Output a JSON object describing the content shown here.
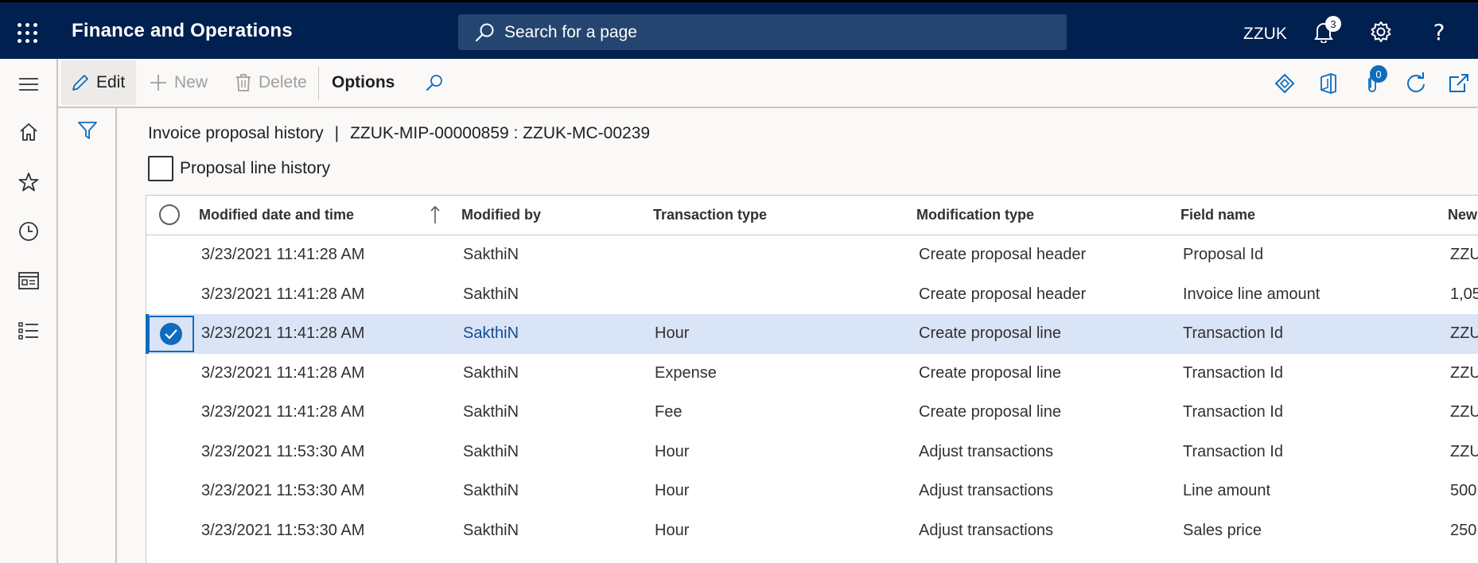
{
  "app": {
    "title": "Finance and Operations",
    "search_placeholder": "Search for a page",
    "company": "ZZUK",
    "notifications_count": "3"
  },
  "nav": {
    "items": [
      "hamburger-icon",
      "home-icon",
      "star-icon",
      "clock-icon",
      "workspace-icon",
      "list-icon"
    ]
  },
  "actions": {
    "edit": "Edit",
    "new": "New",
    "delete": "Delete",
    "options": "Options",
    "attachments_count": "0"
  },
  "page": {
    "caption_title": "Invoice proposal history",
    "caption_separator": "|",
    "caption_record": "ZZUK-MIP-00000859 : ZZUK-MC-00239",
    "proposal_line_history_label": "Proposal line history",
    "proposal_line_history_checked": false
  },
  "grid": {
    "columns": [
      "Modified date and time",
      "Modified by",
      "Transaction type",
      "Modification type",
      "Field name",
      "New"
    ],
    "sorted_column": "Modified date and time",
    "sort_direction": "ascending",
    "rows": [
      {
        "date": "3/23/2021 11:41:28 AM",
        "by": "SakthiN",
        "type": "",
        "mod": "Create proposal header",
        "field": "Proposal Id",
        "new": "ZZU"
      },
      {
        "date": "3/23/2021 11:41:28 AM",
        "by": "SakthiN",
        "type": "",
        "mod": "Create proposal header",
        "field": "Invoice line amount",
        "new": "1,05"
      },
      {
        "date": "3/23/2021 11:41:28 AM",
        "by": "SakthiN",
        "type": "Hour",
        "mod": "Create proposal line",
        "field": "Transaction Id",
        "new": "ZZU"
      },
      {
        "date": "3/23/2021 11:41:28 AM",
        "by": "SakthiN",
        "type": "Expense",
        "mod": "Create proposal line",
        "field": "Transaction Id",
        "new": "ZZU"
      },
      {
        "date": "3/23/2021 11:41:28 AM",
        "by": "SakthiN",
        "type": "Fee",
        "mod": "Create proposal line",
        "field": "Transaction Id",
        "new": "ZZU"
      },
      {
        "date": "3/23/2021 11:53:30 AM",
        "by": "SakthiN",
        "type": "Hour",
        "mod": "Adjust transactions",
        "field": "Transaction Id",
        "new": "ZZU"
      },
      {
        "date": "3/23/2021 11:53:30 AM",
        "by": "SakthiN",
        "type": "Hour",
        "mod": "Adjust transactions",
        "field": "Line amount",
        "new": "500."
      },
      {
        "date": "3/23/2021 11:53:30 AM",
        "by": "SakthiN",
        "type": "Hour",
        "mod": "Adjust transactions",
        "field": "Sales price",
        "new": "250."
      }
    ],
    "selected_row": 2
  },
  "colors": {
    "topbar": "#002050",
    "accent": "#0f6cbd",
    "selected_row": "#d9e4f6"
  }
}
